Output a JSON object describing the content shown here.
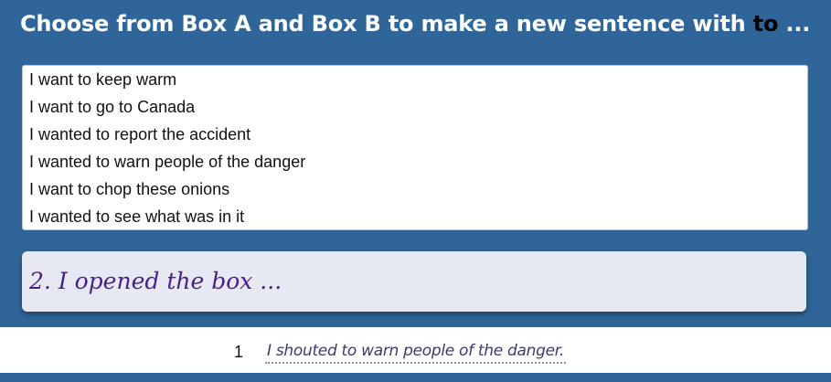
{
  "header": {
    "title_prefix": "Choose from Box A and Box B to make a new sentence with ",
    "title_keyword": "to",
    "title_suffix": " ..."
  },
  "box_a": {
    "options": [
      "I want to keep warm",
      "I want to go to Canada",
      "I wanted to report the accident",
      "I wanted to warn people of the danger",
      "I want to chop these onions",
      "I wanted to see what was in it"
    ]
  },
  "box_b": {
    "prompt": "2. I opened the box ..."
  },
  "answers": [
    {
      "number": "1",
      "text": "I shouted to warn people of the danger."
    }
  ],
  "colors": {
    "background": "#2f6598",
    "prompt_text": "#4a1f8a",
    "box_b_background": "#e6e8f2"
  }
}
